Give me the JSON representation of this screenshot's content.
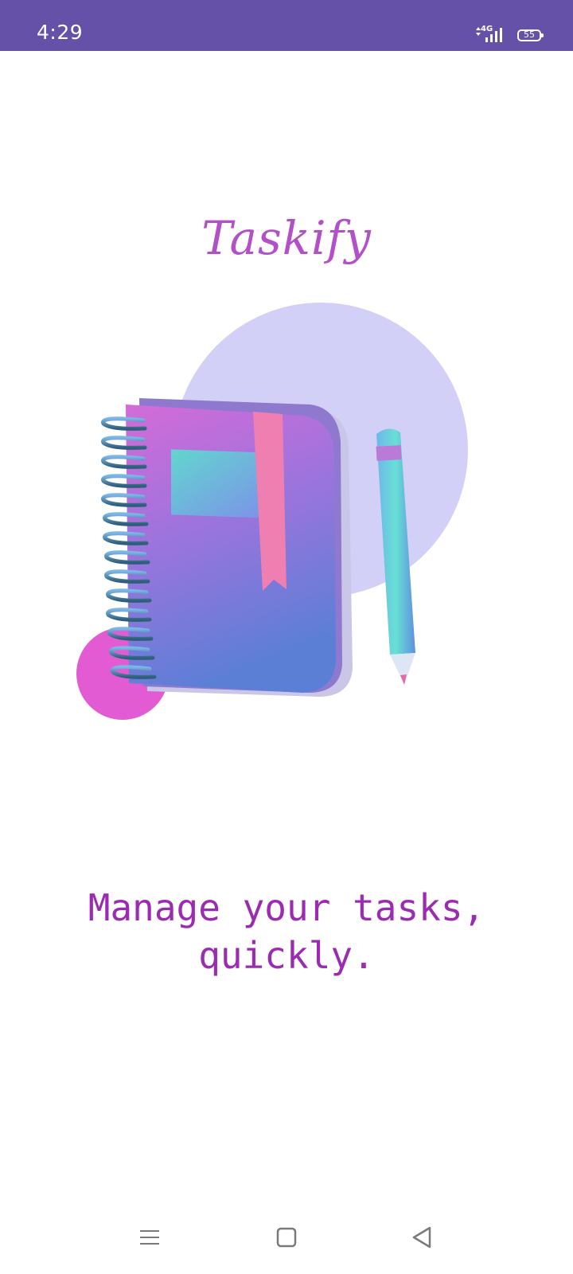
{
  "status_bar": {
    "time": "4:29",
    "network": "4G",
    "battery": "55",
    "background": "#6651a8"
  },
  "app": {
    "title": "Taskify",
    "tagline": "Manage your tasks,\nquickly.",
    "accent": "#b24fc9",
    "tagline_color": "#9b2cb2"
  },
  "illustration": {
    "description_icons": [
      "notebook-icon",
      "pencil-icon"
    ]
  },
  "nav_bar": {
    "icons": [
      "menu-icon",
      "home-icon",
      "back-icon"
    ]
  }
}
